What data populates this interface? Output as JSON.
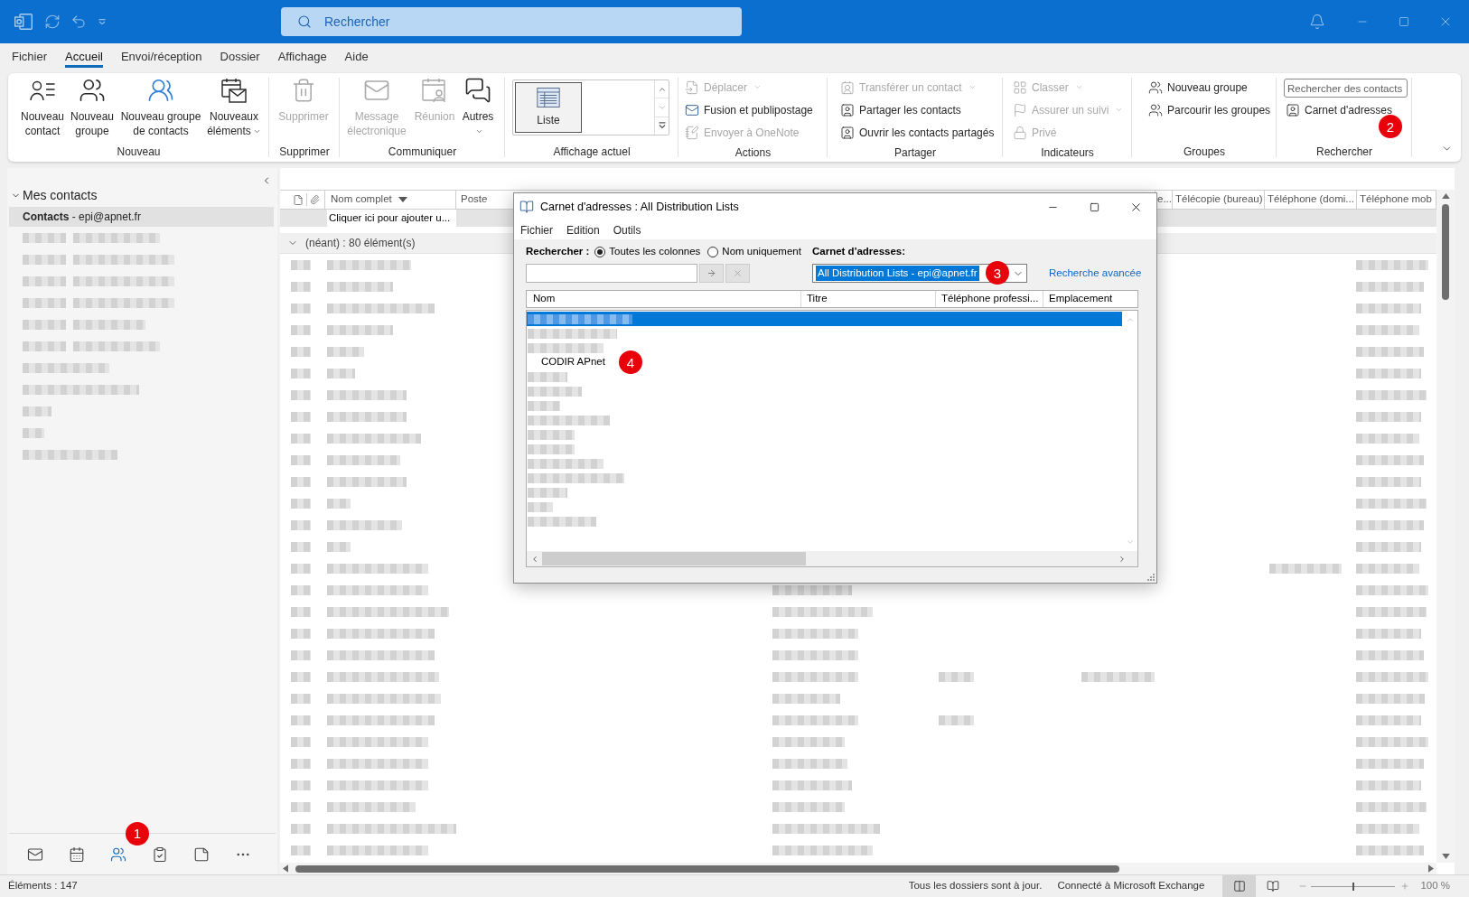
{
  "title_bar": {
    "search_placeholder": "Rechercher"
  },
  "menu_tabs": [
    {
      "label": "Fichier",
      "selected": false
    },
    {
      "label": "Accueil",
      "selected": true
    },
    {
      "label": "Envoi/réception",
      "selected": false
    },
    {
      "label": "Dossier",
      "selected": false
    },
    {
      "label": "Affichage",
      "selected": false
    },
    {
      "label": "Aide",
      "selected": false
    }
  ],
  "ribbon": {
    "groups": [
      {
        "label": "Nouveau",
        "items": [
          {
            "kind": "large",
            "label": "Nouveau contact",
            "disabled": false,
            "dropdown": false
          },
          {
            "kind": "large",
            "label": "Nouveau groupe",
            "disabled": false,
            "dropdown": false
          },
          {
            "kind": "large",
            "label": "Nouveau groupe de contacts",
            "disabled": false,
            "dropdown": false
          },
          {
            "kind": "large",
            "label": "Nouveaux éléments",
            "disabled": false,
            "dropdown": true
          }
        ]
      },
      {
        "label": "Supprimer",
        "items": [
          {
            "kind": "large",
            "label": "Supprimer",
            "disabled": true,
            "dropdown": false
          }
        ]
      },
      {
        "label": "Communiquer",
        "items": [
          {
            "kind": "large",
            "label": "Message électronique",
            "disabled": true,
            "dropdown": false
          },
          {
            "kind": "large",
            "label": "Réunion",
            "disabled": true,
            "dropdown": false
          },
          {
            "kind": "large",
            "label": "Autres",
            "disabled": false,
            "dropdown": true
          }
        ]
      },
      {
        "label": "Affichage actuel",
        "items": [
          {
            "kind": "gallery",
            "label": "Liste",
            "selected": true
          }
        ]
      },
      {
        "label": "Actions",
        "items": [
          {
            "kind": "small",
            "label": "Déplacer",
            "disabled": true,
            "dropdown": true
          },
          {
            "kind": "small",
            "label": "Fusion et publipostage",
            "disabled": false,
            "dropdown": false
          },
          {
            "kind": "small",
            "label": "Envoyer à OneNote",
            "disabled": true,
            "dropdown": false
          }
        ]
      },
      {
        "label": "Partager",
        "items": [
          {
            "kind": "small",
            "label": "Transférer un contact",
            "disabled": true,
            "dropdown": true
          },
          {
            "kind": "small",
            "label": "Partager les contacts",
            "disabled": false,
            "dropdown": false
          },
          {
            "kind": "small",
            "label": "Ouvrir les contacts partagés",
            "disabled": false,
            "dropdown": false
          }
        ]
      },
      {
        "label": "Indicateurs",
        "items": [
          {
            "kind": "small",
            "label": "Classer",
            "disabled": true,
            "dropdown": true
          },
          {
            "kind": "small",
            "label": "Assurer un suivi",
            "disabled": true,
            "dropdown": true
          },
          {
            "kind": "small",
            "label": "Privé",
            "disabled": true,
            "dropdown": false
          }
        ]
      },
      {
        "label": "Groupes",
        "items": [
          {
            "kind": "small",
            "label": "Nouveau groupe",
            "disabled": false,
            "dropdown": false
          },
          {
            "kind": "small",
            "label": "Parcourir les groupes",
            "disabled": false,
            "dropdown": false
          }
        ]
      },
      {
        "label": "Rechercher",
        "annotation": "2",
        "items": [
          {
            "kind": "field",
            "placeholder": "Rechercher des contacts"
          },
          {
            "kind": "small",
            "label": "Carnet d'adresses",
            "disabled": false,
            "dropdown": false
          }
        ]
      }
    ]
  },
  "navigation_pane": {
    "header": {
      "label": "Mes contacts",
      "expanded": true
    },
    "folders": [
      {
        "label": "**Contacts** - epi@apnet.fr",
        "selected": true
      }
    ],
    "modules": [
      {
        "selected": false
      },
      {
        "selected": false
      },
      {
        "selected": true,
        "annotation": "1"
      },
      {
        "selected": false
      },
      {
        "selected": false
      },
      {
        "selected": false
      }
    ]
  },
  "contact_list": {
    "columns": [
      {
        "label": "Nom complet",
        "sorted": true
      },
      {
        "label": "Poste",
        "sorted": false
      },
      {
        "label": "e...",
        "sorted": false
      },
      {
        "label": "Télécopie (bureau)",
        "sorted": false
      },
      {
        "label": "Téléphone (domi...",
        "sorted": false
      },
      {
        "label": "Téléphone mob",
        "sorted": false
      }
    ],
    "new_item_prompt": "Cliquer ici pour ajouter u...",
    "group": {
      "label": "(néant) : 80 élément(s)",
      "expanded": true
    }
  },
  "dialog": {
    "title": "Carnet d'adresses : All Distribution Lists",
    "menu": [
      "Fichier",
      "Edition",
      "Outils"
    ],
    "search": {
      "label": "Rechercher :",
      "options": [
        {
          "label": "Toutes les colonnes",
          "selected": true
        },
        {
          "label": "Nom uniquement",
          "selected": false
        }
      ]
    },
    "address_book": {
      "label": "Carnet d'adresses:",
      "value": "All Distribution Lists - epi@apnet.fr",
      "text_selected": true,
      "annotation": "3"
    },
    "advanced_search": "Recherche avancée",
    "columns": [
      "Nom",
      "Titre",
      "Téléphone professi...",
      "Emplacement"
    ],
    "rows": [
      {
        "kind": "blurred",
        "selected": true
      },
      {
        "kind": "blurred",
        "selected": false
      },
      {
        "kind": "blurred",
        "selected": false
      },
      {
        "kind": "name",
        "name": "CODIR APnet",
        "selected": false,
        "annotation": "4"
      },
      {
        "kind": "blurred",
        "selected": false
      },
      {
        "kind": "blurred",
        "selected": false
      },
      {
        "kind": "blurred",
        "selected": false
      },
      {
        "kind": "blurred",
        "selected": false
      },
      {
        "kind": "blurred",
        "selected": false
      },
      {
        "kind": "blurred",
        "selected": false
      },
      {
        "kind": "blurred",
        "selected": false
      },
      {
        "kind": "blurred",
        "selected": false
      },
      {
        "kind": "blurred",
        "selected": false
      },
      {
        "kind": "blurred",
        "selected": false
      },
      {
        "kind": "blurred",
        "selected": false
      }
    ]
  },
  "status_bar": {
    "items_count": "Éléments : 147",
    "sync_status": "Tous les dossiers sont à jour.",
    "connection": "Connecté à Microsoft Exchange",
    "views": [
      {
        "selected": true
      },
      {
        "selected": false
      }
    ],
    "zoom": {
      "level": 0.5,
      "reading": "100 %"
    }
  }
}
